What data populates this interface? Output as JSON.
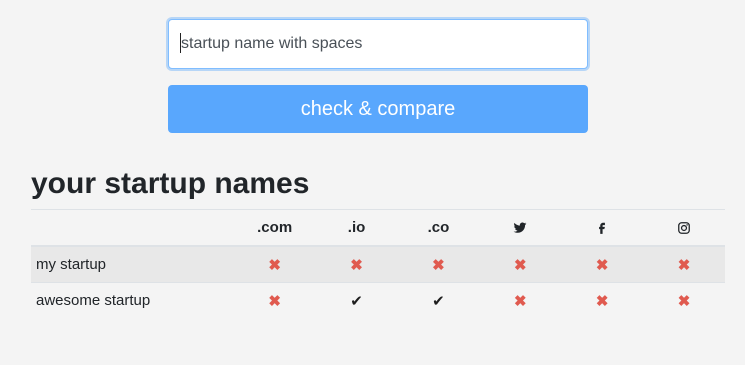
{
  "search": {
    "placeholder": "startup name with spaces",
    "value": ""
  },
  "button": {
    "label": "check & compare"
  },
  "section": {
    "title": "your startup names"
  },
  "table": {
    "columns": [
      {
        "label": ".com",
        "type": "text"
      },
      {
        "label": ".io",
        "type": "text"
      },
      {
        "label": ".co",
        "type": "text"
      },
      {
        "icon": "twitter-icon",
        "type": "icon"
      },
      {
        "icon": "facebook-icon",
        "type": "icon"
      },
      {
        "icon": "instagram-icon",
        "type": "icon"
      }
    ],
    "rows": [
      {
        "name": "my startup",
        "results": [
          "unavailable",
          "unavailable",
          "unavailable",
          "unavailable",
          "unavailable",
          "unavailable"
        ]
      },
      {
        "name": "awesome startup",
        "results": [
          "unavailable",
          "available",
          "available",
          "unavailable",
          "unavailable",
          "unavailable"
        ]
      }
    ]
  },
  "glyphs": {
    "available": "✔",
    "unavailable": "✖"
  },
  "colors": {
    "accent": "#59a7fd",
    "unavailable": "#e05a4f",
    "available": "#1e1e1e",
    "background": "#f4f4f4"
  }
}
